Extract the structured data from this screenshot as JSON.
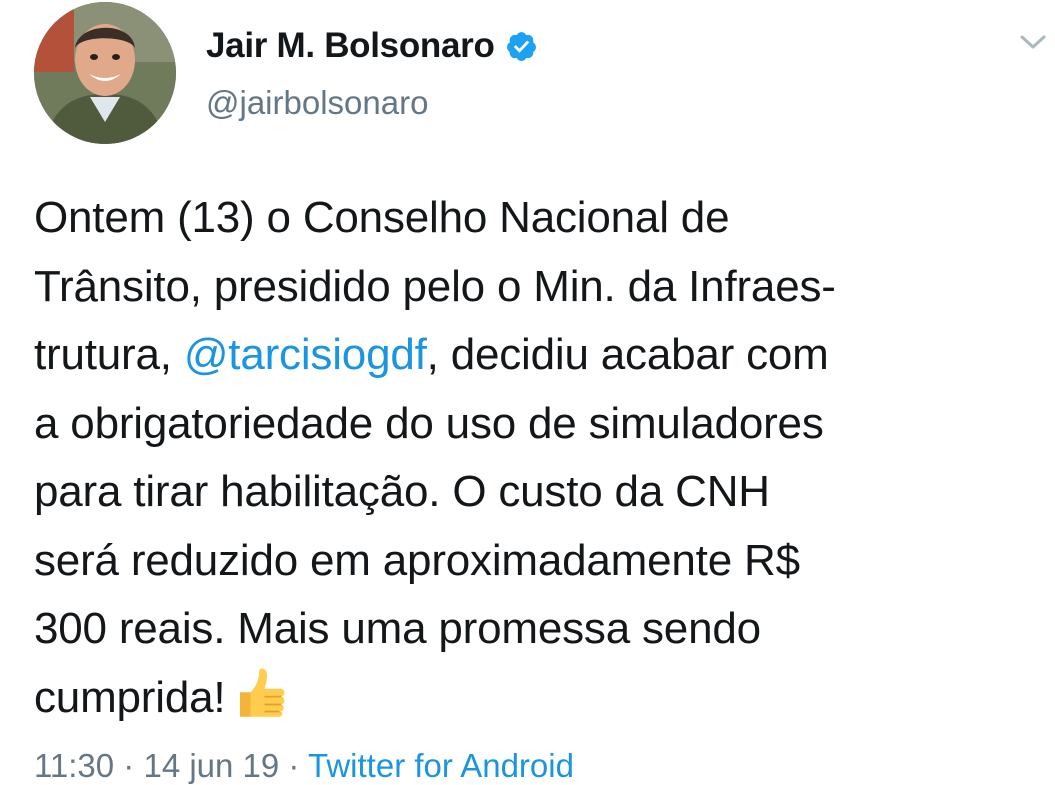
{
  "author": {
    "display_name": "Jair M. Bolsonaro",
    "handle": "@jairbolsonaro",
    "verified": true,
    "avatar_icon": "profile-photo"
  },
  "tweet": {
    "line1": "Ontem (13) o Conselho Nacional de",
    "line2": "Trânsito, presidido pelo o Min. da Infraes-",
    "line3_before": "trutura, ",
    "line3_mention": "@tarcisiogdf",
    "line3_after": ", decidiu acabar com",
    "line4": "a obrigatoriedade do uso de simuladores",
    "line5": "para tirar habilitação. O custo da CNH",
    "line6": "será reduzido em aproximadamente R$",
    "line7": "300 reais. Mais uma promessa sendo",
    "line8": "cumprida!",
    "emoji_icon": "thumbs-up-icon"
  },
  "meta": {
    "time": "11:30",
    "separator": " · ",
    "date": "14 jun 19",
    "source": "Twitter for Android"
  },
  "colors": {
    "text": "#14171a",
    "secondary": "#657786",
    "link": "#1b95e0",
    "verified": "#1da1f2"
  }
}
